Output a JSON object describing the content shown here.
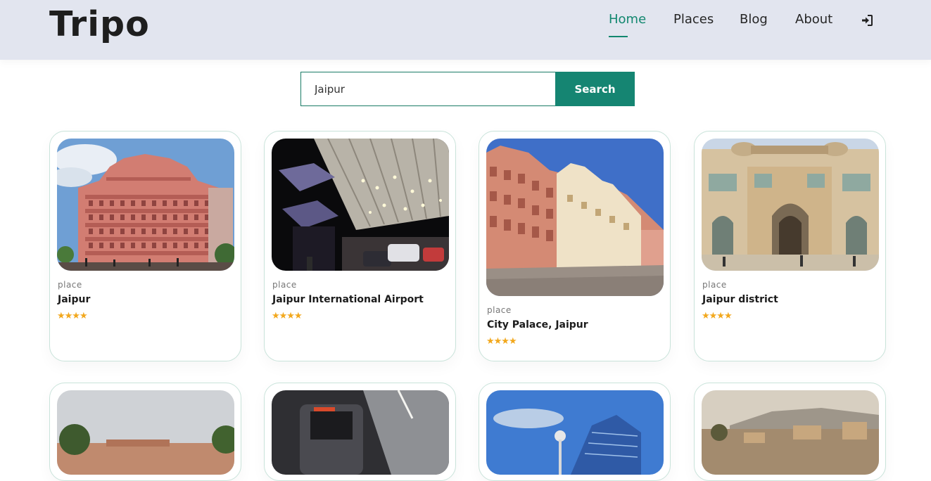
{
  "header": {
    "logo": "Tripo",
    "nav": [
      {
        "label": "Home",
        "active": true
      },
      {
        "label": "Places",
        "active": false
      },
      {
        "label": "Blog",
        "active": false
      },
      {
        "label": "About",
        "active": false
      }
    ],
    "login_icon": "sign-in-icon",
    "accent_color": "#12876f"
  },
  "search": {
    "value": "Jaipur",
    "button_label": "Search"
  },
  "cards": [
    {
      "category": "place",
      "title": "Jaipur",
      "rating_stars": 4,
      "stars": "★★★★",
      "image": "hawa-mahal-photo"
    },
    {
      "category": "place",
      "title": "Jaipur International Airport",
      "rating_stars": 4,
      "stars": "★★★★",
      "image": "airport-terminal-photo"
    },
    {
      "category": "place",
      "title": "City Palace, Jaipur",
      "rating_stars": 4,
      "stars": "★★★★",
      "image": "city-palace-photo"
    },
    {
      "category": "place",
      "title": "Jaipur district",
      "rating_stars": 4,
      "stars": "★★★★",
      "image": "amber-fort-gate-photo"
    },
    {
      "image": "railway-station-photo"
    },
    {
      "image": "metro-train-photo"
    },
    {
      "image": "glass-tower-photo"
    },
    {
      "image": "hill-town-photo"
    }
  ]
}
